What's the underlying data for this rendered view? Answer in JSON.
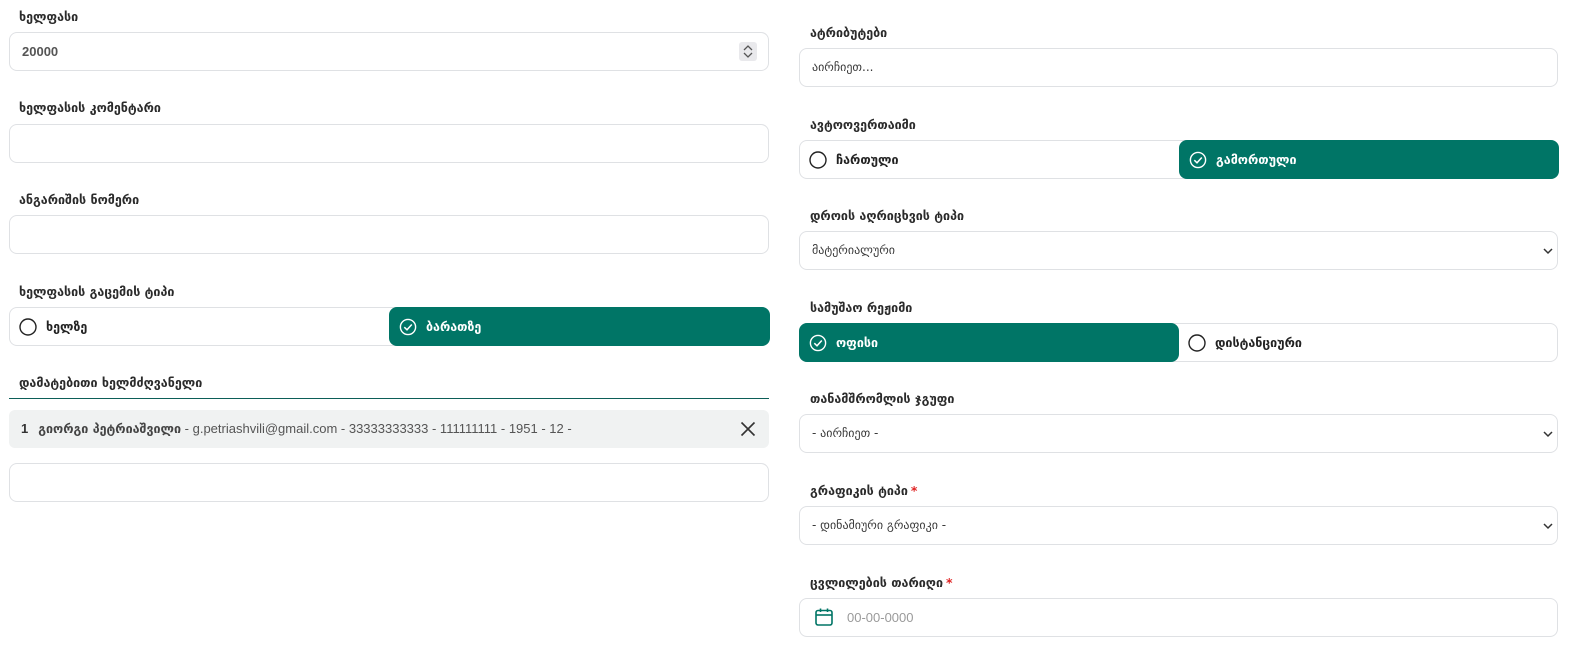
{
  "left": {
    "salary": {
      "label": "ხელფასი",
      "value": "20000"
    },
    "salary_comment": {
      "label": "ხელფასის კომენტარი",
      "value": ""
    },
    "account_number": {
      "label": "ანგარიშის ნომერი",
      "value": ""
    },
    "salary_issue_type": {
      "label": "ხელფასის გაცემის ტიპი",
      "options": [
        "ხელზე",
        "ბარათზე"
      ],
      "selected": "ბარათზე"
    },
    "extra_manager": {
      "label": "დამატებითი ხელმძღვანელი",
      "entry": {
        "index": "1",
        "name": "გიორგი პეტრიაშვილი",
        "details": " - g.petriashvili@gmail.com - 33333333333 - 111111111 - 1951 - 12 - "
      },
      "input_value": ""
    }
  },
  "right": {
    "attributes": {
      "label": "ატრიბუტები",
      "value": "აირჩიეთ..."
    },
    "auto_logout": {
      "label": "ავტოოვერთაიმი",
      "options": [
        "ჩართული",
        "გამორთული"
      ],
      "selected": "გამორთული"
    },
    "time_tracking_type": {
      "label": "დროის აღრიცხვის ტიპი",
      "value": "მატერიალური"
    },
    "work_mode": {
      "label": "სამუშაო რეჟიმი",
      "options": [
        "ოფისი",
        "დისტანციური"
      ],
      "selected": "ოფისი"
    },
    "employee_group": {
      "label": "თანამშრომლის ჯგუფი",
      "value": "- აირჩიეთ -"
    },
    "schedule_type": {
      "label": "გრაფიკის ტიპი",
      "required": "*",
      "value": "- დინამიური გრაფიკი -"
    },
    "change_date": {
      "label": "ცვლილების თარიღი",
      "required": "*",
      "placeholder": "00-00-0000"
    }
  },
  "colors": {
    "accent": "#007566",
    "divider": "#0c5e58",
    "required": "#e02424",
    "border": "#dfe1e4"
  },
  "icons": {
    "check_circle": "check-circle-icon",
    "empty_circle": "radio-circle-icon",
    "chevron": "chevron-down-icon",
    "spinner": "number-spinner-icon",
    "close": "close-icon",
    "calendar": "calendar-icon"
  }
}
